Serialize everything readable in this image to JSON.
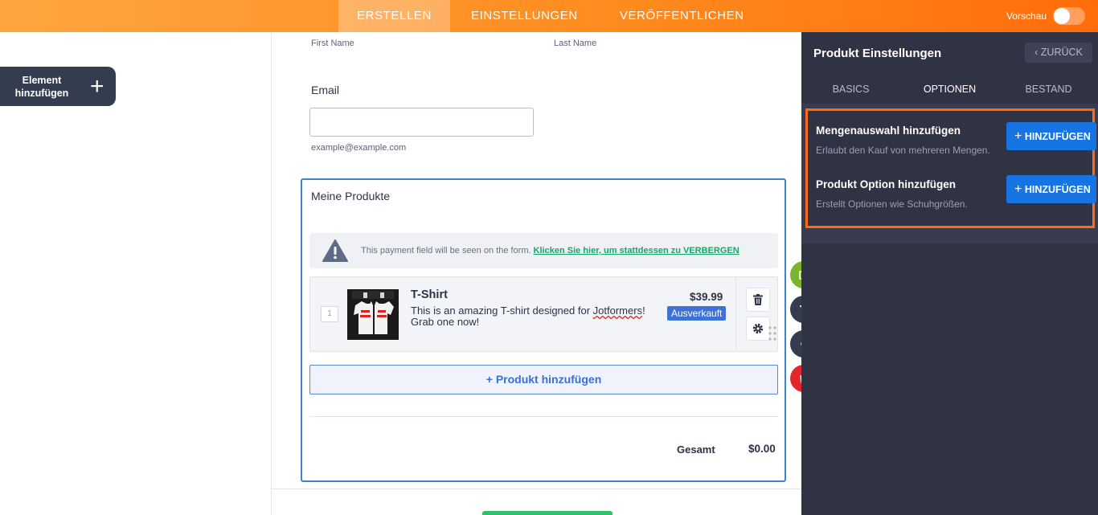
{
  "topbar": {
    "tabs": [
      {
        "label": "ERSTELLEN",
        "active": true
      },
      {
        "label": "EINSTELLUNGEN",
        "active": false
      },
      {
        "label": "VERÖFFENTLICHEN",
        "active": false
      }
    ],
    "preview_label": "Vorschau",
    "preview_enabled": false
  },
  "left_panel": {
    "add_element_label": "Element hinzufügen"
  },
  "form": {
    "first_name_sublabel": "First Name",
    "last_name_sublabel": "Last Name",
    "email_label": "Email",
    "email_value": "",
    "email_sublabel": "example@example.com",
    "products": {
      "title": "Meine Produkte",
      "notice_text": "This payment field will be seen on the form.",
      "notice_link": "Klicken Sie hier, um stattdessen zu VERBERGEN",
      "items": [
        {
          "number": "1",
          "name": "T-Shirt",
          "description_before": "This is an amazing T-shirt designed for ",
          "description_misspelled": "Jotformers",
          "description_after": "! Grab one now!",
          "price": "$39.99",
          "badge": "Ausverkauft"
        }
      ],
      "add_product_label": "+ Produkt hinzufügen",
      "total_label": "Gesamt",
      "total_value": "$0.00"
    }
  },
  "right_panel": {
    "title": "Produkt Einstellungen",
    "back_label": "ZURÜCK",
    "tabs": [
      {
        "label": "BASICS",
        "active": false
      },
      {
        "label": "OPTIONEN",
        "active": true
      },
      {
        "label": "BESTAND",
        "active": false
      }
    ],
    "options": [
      {
        "title": "Mengenauswahl hinzufügen",
        "description": "Erlaubt den Kauf von mehreren Mengen.",
        "button_label": "HINZUFÜGEN"
      },
      {
        "title": "Produkt Option hinzufügen",
        "description": "Erstellt Optionen wie Schuhgrößen.",
        "button_label": "HINZUFÜGEN"
      }
    ]
  },
  "colors": {
    "topbar_start": "#ffa53f",
    "topbar_end": "#ff6d0a",
    "panel_dark": "#2f3343",
    "highlight": "#ff6a17",
    "primary_button": "#1675e3",
    "badge_blue": "#3f72d8",
    "link_green": "#19a86a"
  }
}
